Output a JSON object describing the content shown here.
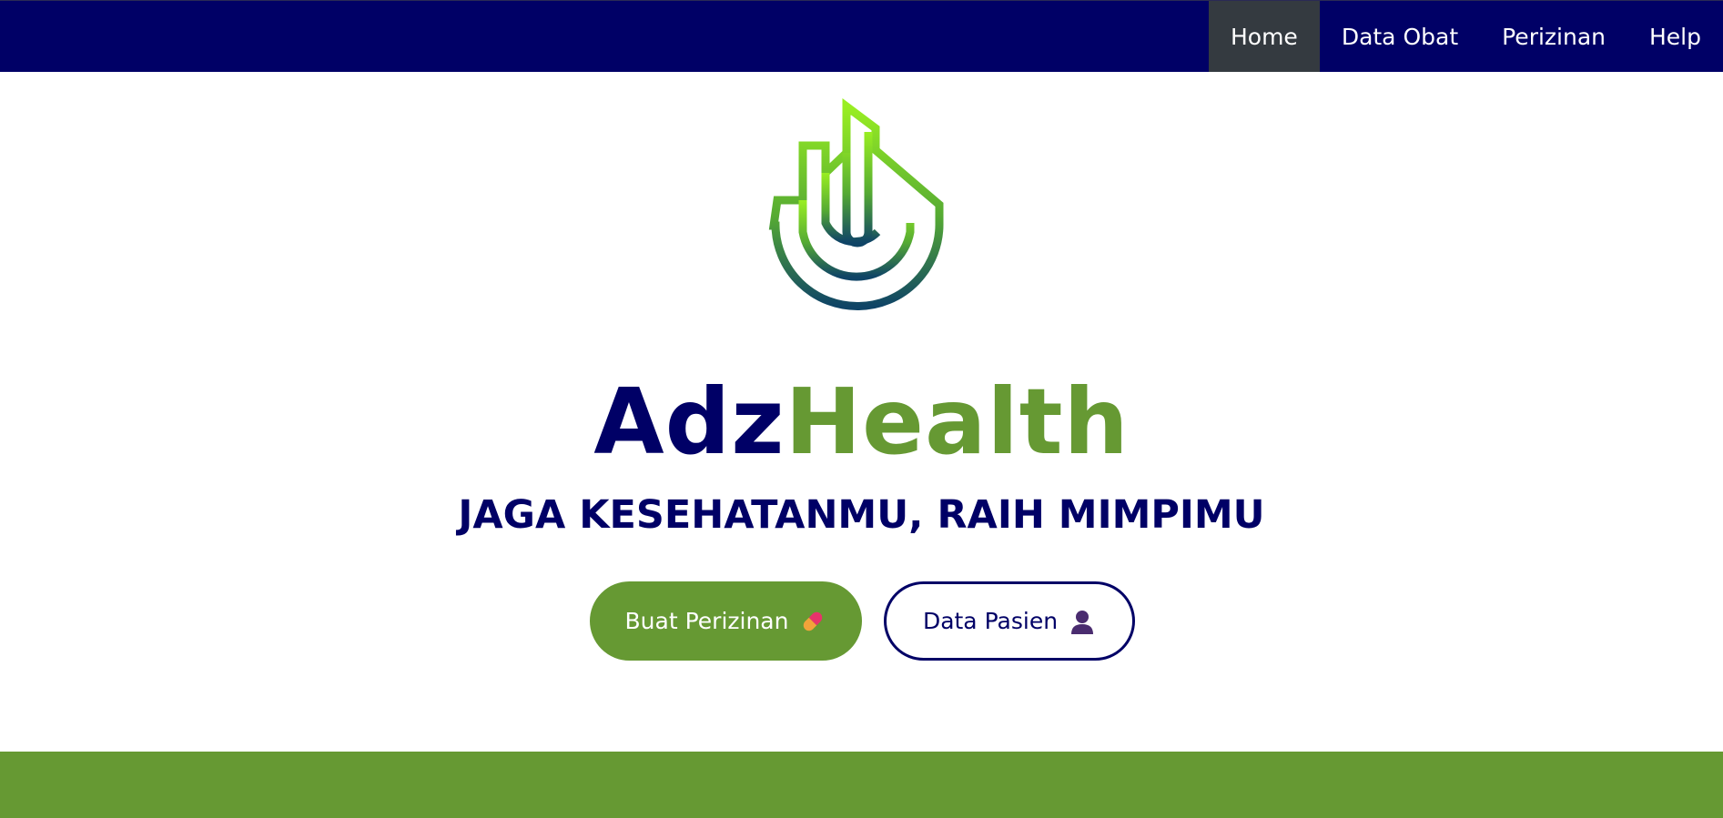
{
  "nav": {
    "items": [
      {
        "label": "Home",
        "active": true
      },
      {
        "label": "Data Obat",
        "active": false
      },
      {
        "label": "Perizinan",
        "active": false
      },
      {
        "label": "Help",
        "active": false
      }
    ]
  },
  "brand": {
    "part1": "Adz",
    "part2": "Health"
  },
  "tagline": "JAGA KESEHATANMU, RAIH MIMPIMU",
  "buttons": {
    "primary_label": "Buat Perizinan",
    "primary_icon": "pill-icon",
    "secondary_label": "Data Pasien",
    "secondary_icon": "person-icon"
  },
  "colors": {
    "navy": "#000066",
    "green": "#669933",
    "active_nav_bg": "#343a40"
  }
}
